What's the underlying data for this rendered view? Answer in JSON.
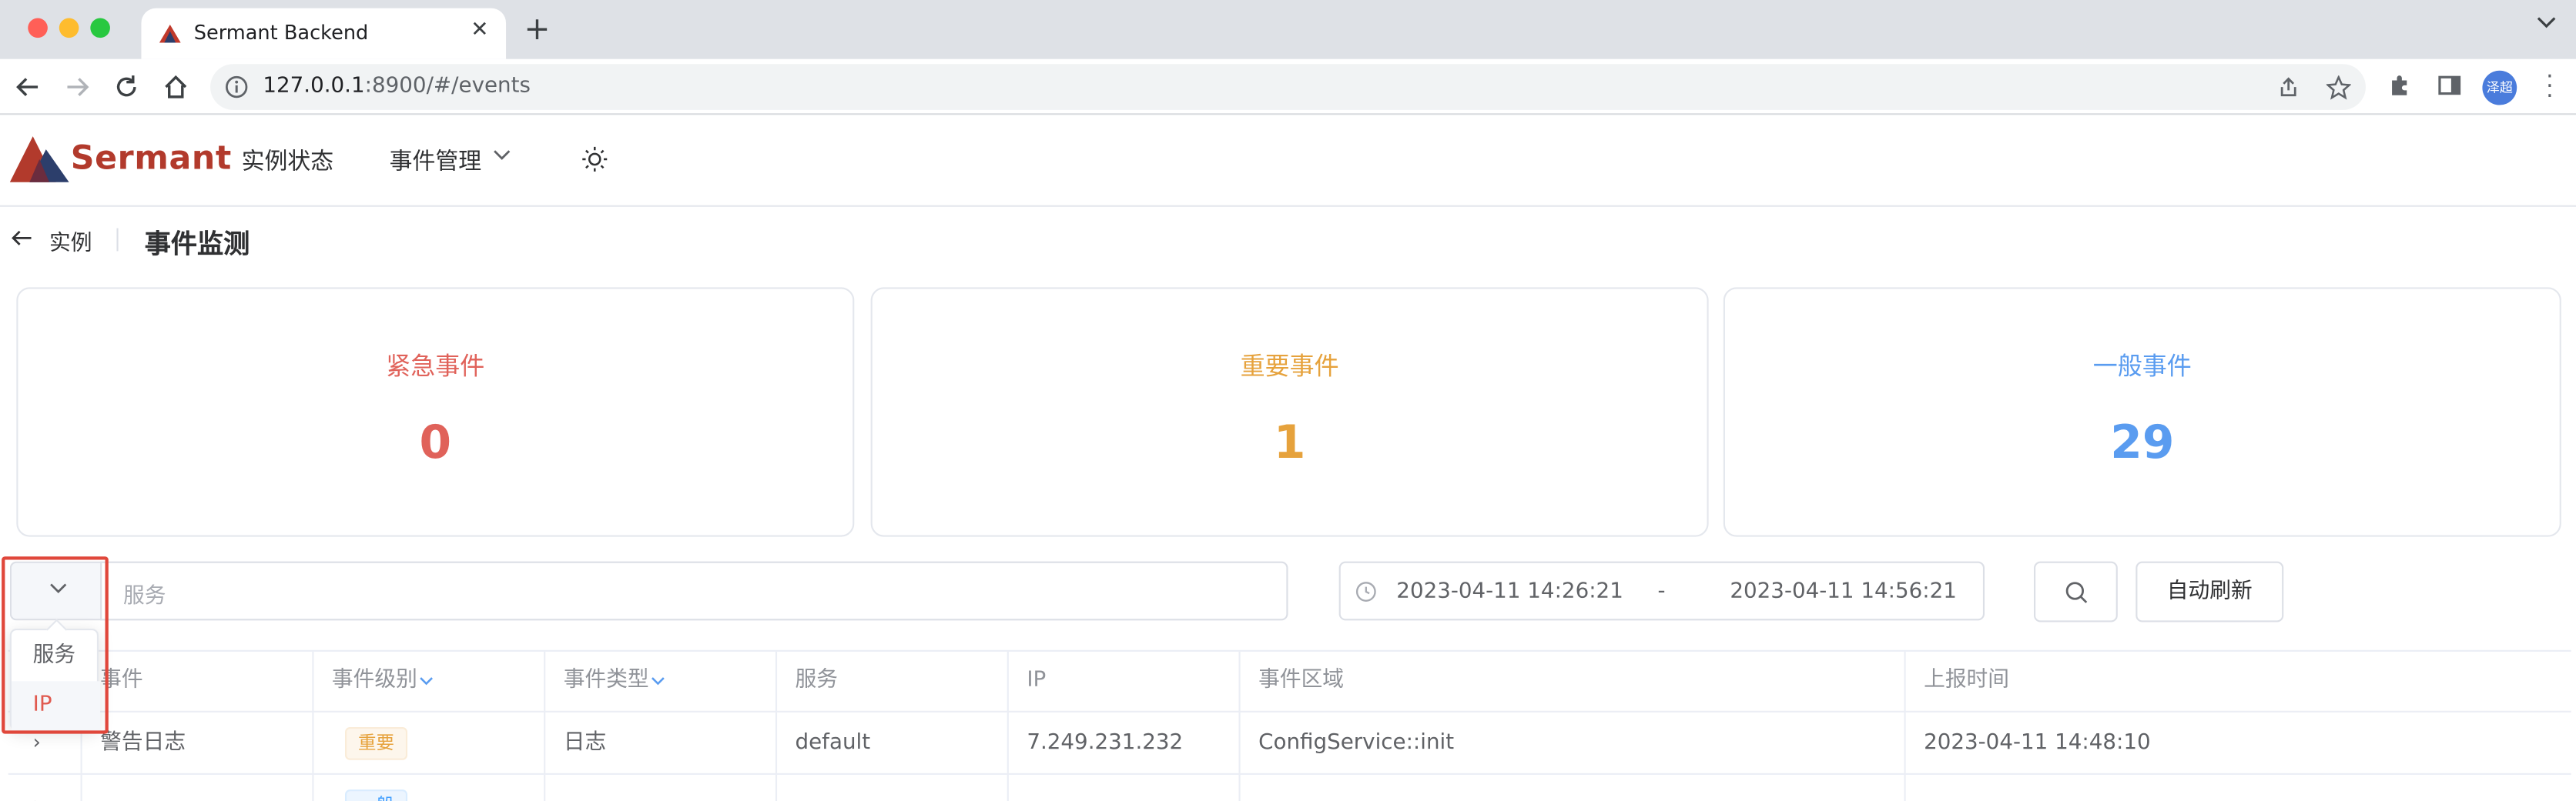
{
  "browser": {
    "tab_title": "Sermant Backend",
    "new_tab": "+",
    "url_host": "127.0.0.1",
    "url_rest": ":8900/#/events",
    "avatar_text": "泽超"
  },
  "header": {
    "logo_text": "Sermant",
    "nav": [
      {
        "label": "实例状态"
      },
      {
        "label": "事件管理"
      }
    ]
  },
  "breadcrumb": {
    "back_label": "实例",
    "title": "事件监测"
  },
  "stats": [
    {
      "label": "紧急事件",
      "value": "0",
      "color": "#e0625a"
    },
    {
      "label": "重要事件",
      "value": "1",
      "color": "#e6a23c"
    },
    {
      "label": "一般事件",
      "value": "29",
      "color": "#5a9cf0"
    }
  ],
  "filter": {
    "search_placeholder": "服务",
    "options": [
      "服务",
      "IP"
    ],
    "selected_option": "IP",
    "date_start": "2023-04-11 14:26:21",
    "date_separator": "-",
    "date_end": "2023-04-11 14:56:21",
    "refresh_label": "自动刷新"
  },
  "table": {
    "columns": [
      "事件",
      "事件级别",
      "事件类型",
      "服务",
      "IP",
      "事件区域",
      "上报时间"
    ],
    "rows": [
      {
        "event": "警告日志",
        "level": "重要",
        "type": "日志",
        "service": "default",
        "ip": "7.249.231.232",
        "area": "ConfigService::init",
        "time": "2023-04-11 14:48:10"
      },
      {
        "event": "",
        "level": "一般",
        "type": "",
        "service": "",
        "ip": "",
        "area": "",
        "time": ""
      }
    ]
  },
  "colors": {
    "brand": "#b23a2c",
    "highlight_border": "#e0473b"
  }
}
